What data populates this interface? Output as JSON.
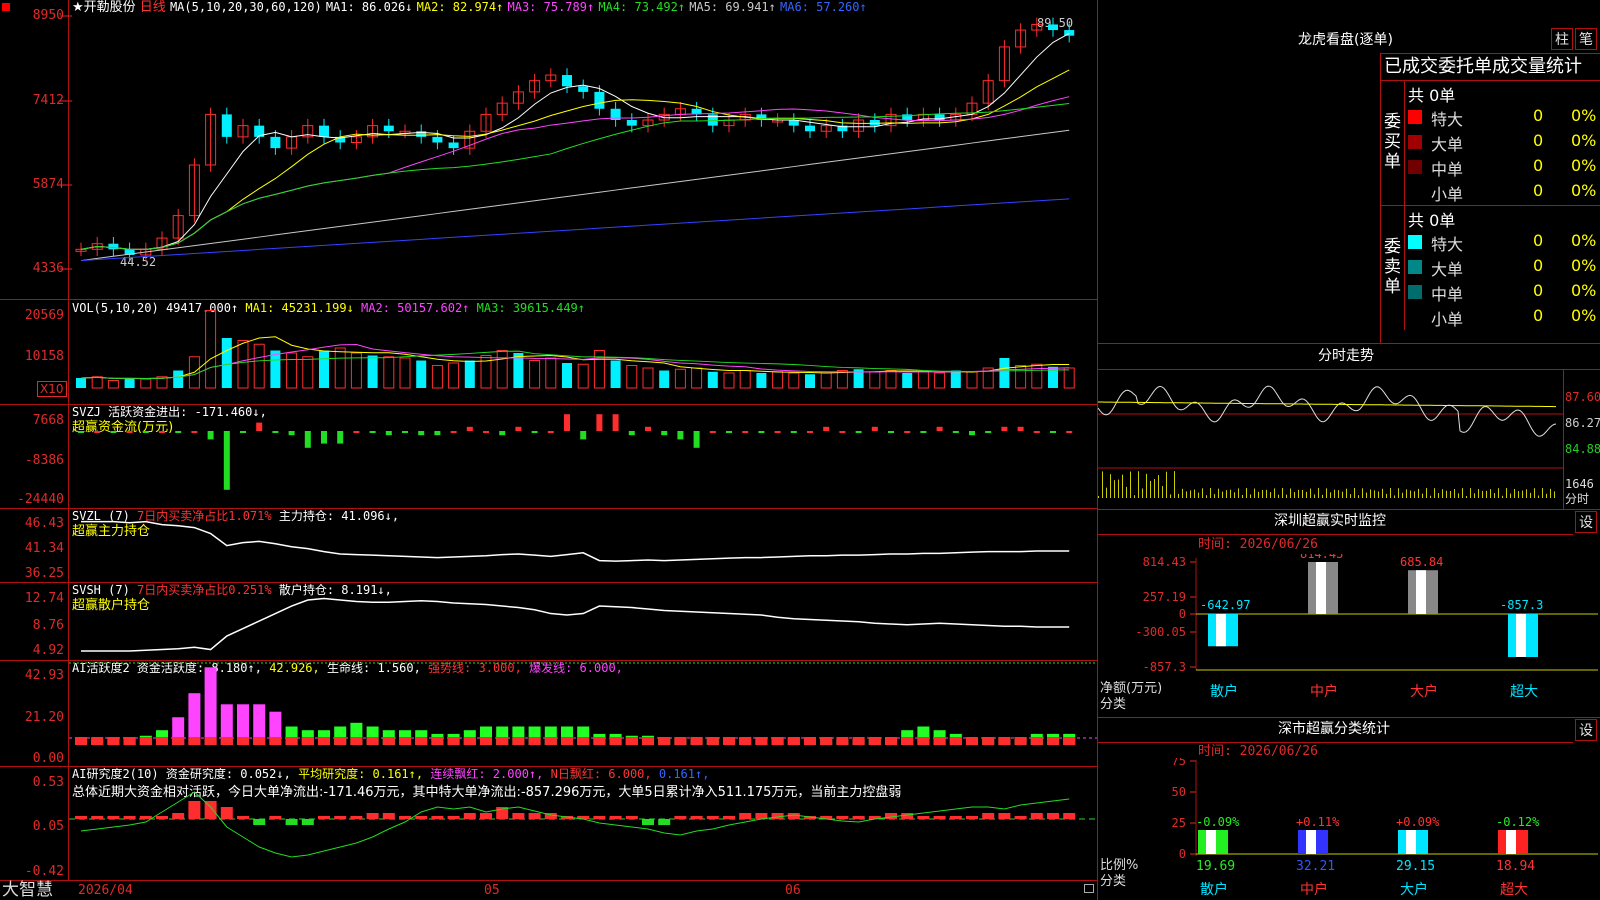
{
  "stock": {
    "star_name": "★开勒股份",
    "period": "日线",
    "logo": "大智慧",
    "date_label": "2026/04",
    "month_05": "05",
    "month_06": "06"
  },
  "ma_line": {
    "label": "MA(5,10,20,30,60,120)",
    "ma1": "MA1: 86.026↓",
    "ma2": "MA2: 82.974↑",
    "ma3": "MA3: 75.789↑",
    "ma4": "MA4: 73.492↑",
    "ma5": "MA5: 69.941↑",
    "ma6": "MA6: 57.260↑",
    "high_mark": "89.50",
    "low_mark": "44.52"
  },
  "price_axis": [
    "8950",
    "7412",
    "5874",
    "4336"
  ],
  "vol": {
    "label": "VOL(5,10,20)",
    "value": "49417.000↑",
    "ma1": "MA1: 45231.199↓",
    "ma2": "MA2: 50157.602↑",
    "ma3": "MA3: 39615.449↑",
    "axis": [
      "20569",
      "10158"
    ],
    "unit": "X10"
  },
  "svzj": {
    "label": "SVZJ  活跃资金进出: -171.460↓,",
    "sub": "超赢资金流(万元)",
    "axis": [
      "7668",
      "-8386",
      "-24440"
    ]
  },
  "svzl": {
    "label": "SVZL (7)",
    "desc": "7日内买卖净占比1.071%",
    "hold": "主力持仓: 41.096↓,",
    "sub": "超赢主力持仓",
    "axis": [
      "46.43",
      "41.34",
      "36.25"
    ]
  },
  "svsh": {
    "label": "SVSH (7)",
    "desc": "7日内买卖净占比0.251%",
    "hold": "散户持仓: 8.191↓,",
    "sub": "超赢散户持仓",
    "axis": [
      "12.74",
      "8.76",
      "4.92"
    ]
  },
  "ai_active": {
    "label": "AI活跃度2",
    "v1": "资金活跃度: 8.180↑,",
    "v2": "42.926,",
    "v3": "生命线: 1.560,",
    "v4": "强势线: 3.000,",
    "v5": "爆发线: 6.000,",
    "axis": [
      "42.93",
      "21.20",
      "0.00"
    ]
  },
  "ai_research": {
    "label": "AI研究度2(10)",
    "v1": "资金研究度: 0.052↓,",
    "v2": "平均研究度: 0.161↑,",
    "v3": "连续飘红: 2.000↑,",
    "v4": "N日飘红: 6.000,",
    "v5": "0.161↑,",
    "summary": "总体近期大资金相对活跃，今日大单净流出:-171.46万元，其中特大单净流出:-857.296万元，大单5日累计净入511.175万元，当前主力控盘弱",
    "axis": [
      "0.53",
      "0.05",
      "-0.42"
    ]
  },
  "dragon": {
    "title": "龙虎看盘(逐单)",
    "btn_bar": "柱",
    "btn_pen": "笔",
    "header": "已成交委托单成交量统计",
    "buy_label": "委买单",
    "sell_label": "委卖单",
    "buy_total": "共 0单",
    "sell_total": "共 0单",
    "buy_rows": [
      {
        "name": "特大",
        "vol": "0",
        "pct": "0%",
        "color": "#ff0000"
      },
      {
        "name": "大单",
        "vol": "0",
        "pct": "0%",
        "color": "#a00000"
      },
      {
        "name": "中单",
        "vol": "0",
        "pct": "0%",
        "color": "#700000"
      },
      {
        "name": "小单",
        "vol": "0",
        "pct": "0%",
        "color": "#000000"
      }
    ],
    "sell_rows": [
      {
        "name": "特大",
        "vol": "0",
        "pct": "0%",
        "color": "#00ffff"
      },
      {
        "name": "大单",
        "vol": "0",
        "pct": "0%",
        "color": "#008888"
      },
      {
        "name": "中单",
        "vol": "0",
        "pct": "0%",
        "color": "#006c6c"
      },
      {
        "name": "小单",
        "vol": "0",
        "pct": "0%",
        "color": "#000000"
      }
    ]
  },
  "intraday": {
    "title": "分时走势",
    "axis": [
      "87.60",
      "86.27",
      "84.88",
      "1646",
      "分时"
    ]
  },
  "sz_monitor": {
    "title": "深圳超赢实时监控",
    "set": "设",
    "time": "时间: 2026/06/26",
    "axis": [
      "814.43",
      "257.19",
      "0",
      "-300.05",
      "-857.3"
    ],
    "ylabel": "净额(万元)",
    "xlabel": "分类",
    "bars": [
      {
        "cat": "散户",
        "val": "-642.97"
      },
      {
        "cat": "中户",
        "val": "814.43"
      },
      {
        "cat": "大户",
        "val": "685.84"
      },
      {
        "cat": "超大",
        "val": "-857.3"
      }
    ]
  },
  "sz_class": {
    "title": "深市超赢分类统计",
    "set": "设",
    "time": "时间: 2026/06/26",
    "axis": [
      "75",
      "50",
      "25",
      "0"
    ],
    "ylabel": "比例%",
    "xlabel": "分类",
    "bars": [
      {
        "cat": "散户",
        "pct": "19.69",
        "chg": "-0.09%"
      },
      {
        "cat": "中户",
        "pct": "32.21",
        "chg": "+0.11%"
      },
      {
        "cat": "大户",
        "pct": "29.15",
        "chg": "+0.09%"
      },
      {
        "cat": "超大",
        "pct": "18.94",
        "chg": "-0.12%"
      }
    ]
  }
}
